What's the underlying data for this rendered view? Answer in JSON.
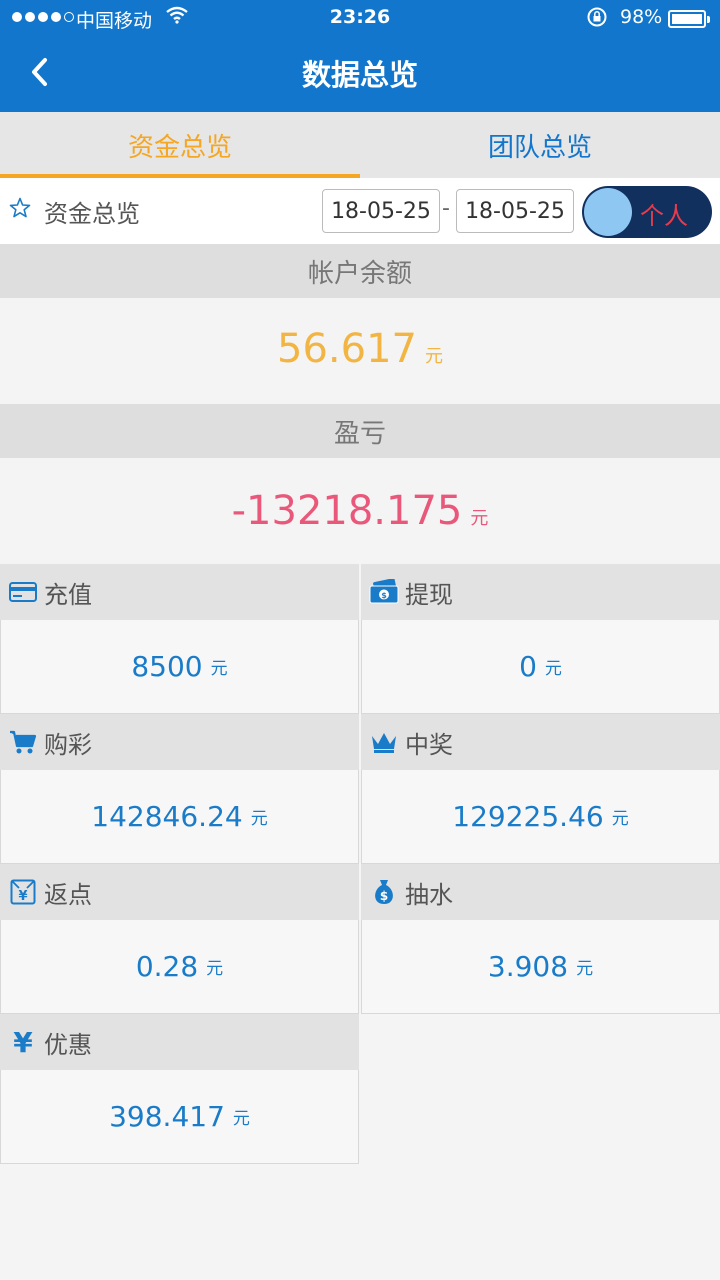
{
  "status": {
    "carrier": "中国移动",
    "time": "23:26",
    "battery": "98%"
  },
  "nav": {
    "title": "数据总览"
  },
  "tabs": [
    {
      "label": "资金总览",
      "active": true
    },
    {
      "label": "团队总览",
      "active": false
    }
  ],
  "filter": {
    "label": "资金总览",
    "date_from": "18-05-25",
    "date_sep": "-",
    "date_to": "18-05-25",
    "toggle_label": "个人"
  },
  "balance": {
    "header": "帐户余额",
    "value": "56.617",
    "unit": "元"
  },
  "profit": {
    "header": "盈亏",
    "value": "-13218.175",
    "unit": "元"
  },
  "stats": [
    {
      "label": "充值",
      "value": "8500",
      "unit": "元",
      "icon": "card-icon"
    },
    {
      "label": "提现",
      "value": "0",
      "unit": "元",
      "icon": "cash-icon"
    },
    {
      "label": "购彩",
      "value": "142846.24",
      "unit": "元",
      "icon": "cart-icon"
    },
    {
      "label": "中奖",
      "value": "129225.46",
      "unit": "元",
      "icon": "crown-icon"
    },
    {
      "label": "返点",
      "value": "0.28",
      "unit": "元",
      "icon": "yen-envelope-icon"
    },
    {
      "label": "抽水",
      "value": "3.908",
      "unit": "元",
      "icon": "money-bag-icon"
    },
    {
      "label": "优惠",
      "value": "398.417",
      "unit": "元",
      "icon": "yen-icon"
    }
  ],
  "colors": {
    "primary": "#1276cc",
    "accent": "#f5a623",
    "balance": "#f2b544",
    "loss": "#e9587a",
    "value": "#1a7cc9"
  }
}
